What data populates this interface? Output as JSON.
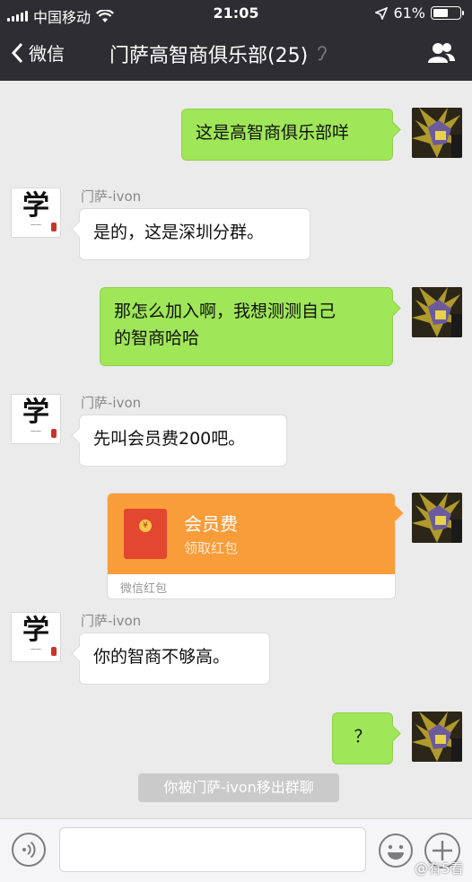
{
  "status_bar": {
    "carrier": "中国移动",
    "time": "21:05",
    "battery_percent": "61%",
    "battery_level": 0.61
  },
  "nav": {
    "back_label": "微信",
    "title": "门萨高智商俱乐部(25)"
  },
  "messages": {
    "m1": {
      "text": "这是高智商俱乐部咩"
    },
    "m2": {
      "sender": "门萨-ivon",
      "text": "是的，这是深圳分群。"
    },
    "m3": {
      "line1": "那怎么加入啊，我想测测自己",
      "line2": "的智商哈哈"
    },
    "m4": {
      "sender": "门萨-ivon",
      "text": "先叫会员费200吧。"
    },
    "m5": {
      "title": "会员费",
      "subtitle": "领取红包",
      "footer": "微信红包"
    },
    "m6": {
      "sender": "门萨-ivon",
      "text": "你的智商不够高。"
    },
    "m7": {
      "text": "？"
    }
  },
  "avatar_other": {
    "glyph": "学"
  },
  "system_notice": "你被门萨-ivon移出群聊",
  "watermark": "@有5看",
  "colors": {
    "nav_bg": "#2e2e32",
    "chat_bg": "#ebebeb",
    "bubble_self": "#9fe658",
    "red_packet": "#f99c3a"
  }
}
